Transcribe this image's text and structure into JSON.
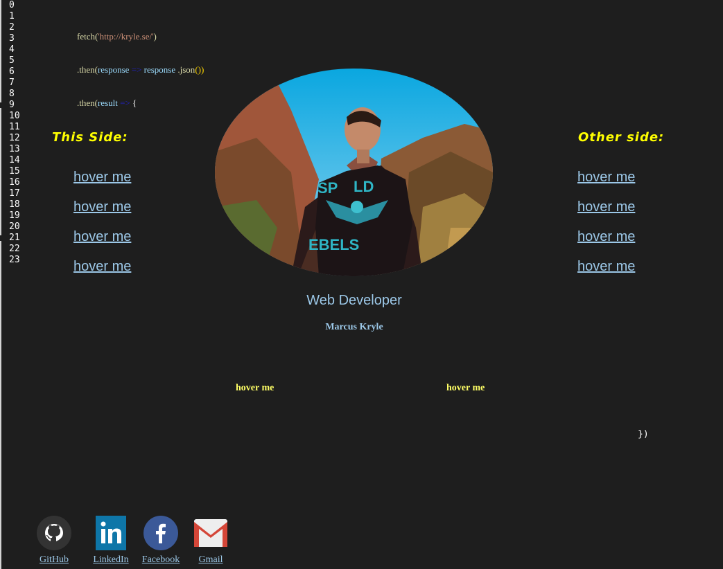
{
  "line_numbers": [
    "0",
    "1",
    "2",
    "3",
    "4",
    "5",
    "6",
    "7",
    "8",
    "9",
    "10",
    "11",
    "12",
    "13",
    "14",
    "15",
    "16",
    "17",
    "18",
    "19",
    "20",
    "21",
    "22",
    "23"
  ],
  "code": {
    "line1_fn": "fetch(",
    "line1_str": "'http://kryle.se/'",
    "line1_end": ")",
    "line2_method": ".then(",
    "line2_param": "response",
    "line2_arrow": " => ",
    "line2_rest": "response",
    "line2_json": " .json",
    "line2_end": "())",
    "line3_method": ".then(",
    "line3_param": "result",
    "line3_arrow": " => ",
    "line3_end": "{",
    "closing": "})"
  },
  "left_side": {
    "title": "This Side:",
    "links": [
      "hover me",
      "hover me",
      "hover me",
      "hover me"
    ]
  },
  "right_side": {
    "title": "Other side:",
    "links": [
      "hover me",
      "hover me",
      "hover me",
      "hover me"
    ]
  },
  "profile": {
    "role": "Web Developer",
    "name": "Marcus Kryle"
  },
  "middle_links": [
    "hover me",
    "hover me"
  ],
  "social": [
    {
      "label": "GitHub",
      "icon": "github-icon",
      "color": "#333333"
    },
    {
      "label": "LinkedIn",
      "icon": "linkedin-icon",
      "color": "#0e76a8"
    },
    {
      "label": "Facebook",
      "icon": "facebook-icon",
      "color": "#3b5998"
    },
    {
      "label": "Gmail",
      "icon": "gmail-icon",
      "color": "#d44638"
    }
  ],
  "colors": {
    "background": "#1e1e1e",
    "accent_yellow": "#ffff00",
    "link_blue": "#9cc8e8"
  }
}
